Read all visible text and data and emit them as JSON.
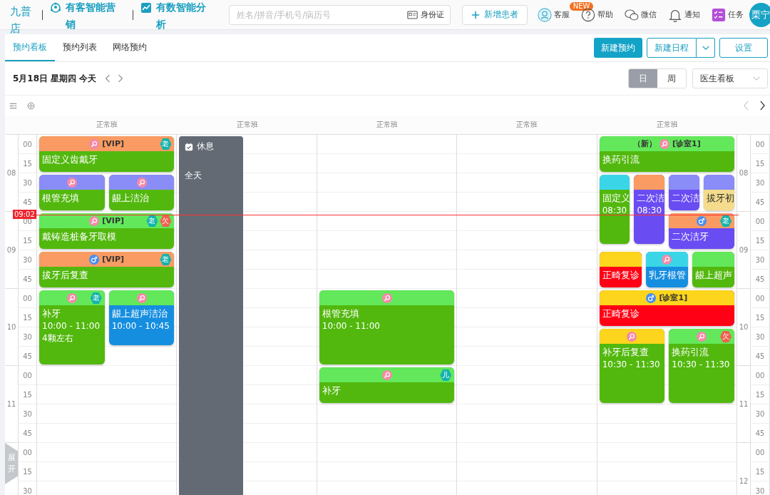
{
  "brand": {
    "name": "九普店"
  },
  "top_links": [
    {
      "kind": "marketing",
      "label": "有客智能营销"
    },
    {
      "kind": "analytics",
      "label": "有数智能分析"
    }
  ],
  "search": {
    "placeholder": "姓名/拼音/手机号/病历号",
    "id_button": "身份证"
  },
  "add_patient": "新增患者",
  "nav": [
    {
      "kind": "service",
      "label": "客服"
    },
    {
      "kind": "help",
      "label": "帮助",
      "badge": "NEW"
    },
    {
      "kind": "wechat",
      "label": "微信"
    },
    {
      "kind": "bell",
      "label": "通知"
    },
    {
      "kind": "tasks",
      "label": "任务"
    }
  ],
  "user": {
    "avatar": "栗宁"
  },
  "tabs": [
    {
      "label": "预约看板",
      "selected": true
    },
    {
      "label": "预约列表",
      "selected": false
    },
    {
      "label": "网络预约",
      "selected": false
    }
  ],
  "actions": {
    "new_appointment": "新建预约",
    "new_schedule": "新建日程",
    "settings": "设置"
  },
  "date": "5月18日 星期四 今天",
  "view_modes": [
    {
      "label": "日",
      "selected": true
    },
    {
      "label": "周",
      "selected": false
    }
  ],
  "board_select": "医生看板",
  "now": "09:02",
  "expand": "展开",
  "left_hours": [
    {
      "label": "08",
      "minutes": [
        "00",
        "15",
        "30",
        "45"
      ]
    },
    {
      "label": "09",
      "minutes": [
        "00",
        "15",
        "30",
        "45"
      ]
    },
    {
      "label": "10",
      "minutes": [
        "00",
        "15",
        "30",
        "45"
      ]
    },
    {
      "label": "11",
      "minutes": [
        "00",
        "15",
        "30",
        "45"
      ]
    },
    {
      "minutes": [
        "00",
        "15",
        "30"
      ]
    }
  ],
  "right_hours": [
    {
      "label": "08",
      "minutes": [
        "00",
        "15",
        "30",
        "45"
      ]
    },
    {
      "label": "09",
      "minutes": [
        "00",
        "15",
        "30",
        "45"
      ]
    },
    {
      "label": "10",
      "minutes": [
        "00",
        "15",
        "30",
        "45"
      ]
    },
    {
      "label": "11",
      "minutes": [
        "00",
        "15",
        "30",
        "45"
      ]
    },
    {
      "label": "12",
      "minutes": [
        "00",
        "15",
        "30"
      ]
    }
  ],
  "columns": [
    {
      "shift": "正常班",
      "events": [
        {
          "kind": "appointment",
          "color": "#52b80e",
          "header": {
            "color": "#f99b62"
          },
          "icon": {
            "kind": "female"
          },
          "tag": "[VIP]",
          "badges": [
            {
              "text": "老",
              "color": "#12b3ad"
            }
          ],
          "lines": [
            "固定义齿戴牙"
          ]
        },
        {
          "kind": "appointment",
          "color": "#52b80e",
          "header": {
            "color": "#8a8cf8"
          },
          "icon": {
            "kind": "female"
          },
          "lines": [
            "根管充填"
          ]
        },
        {
          "kind": "appointment",
          "color": "#52b80e",
          "header": {
            "color": "#8a8cf8"
          },
          "icon": {
            "kind": "female"
          },
          "lines": [
            "龈上洁治"
          ]
        },
        {
          "kind": "appointment",
          "color": "#52b80e",
          "header": {
            "color": "#62e85a"
          },
          "icon": {
            "kind": "female"
          },
          "tag": "[VIP]",
          "badges": [
            {
              "text": "老",
              "color": "#12b3ad"
            },
            {
              "text": "欠",
              "color": "#f0604f"
            }
          ],
          "lines": [
            "戴铸造桩备牙取模"
          ]
        },
        {
          "kind": "appointment",
          "color": "#52b80e",
          "header": {
            "color": "#f99b62"
          },
          "icon": {
            "kind": "male"
          },
          "tag": "[VIP]",
          "badges": [
            {
              "text": "老",
              "color": "#12b3ad"
            }
          ],
          "lines": [
            "拔牙后复查"
          ]
        },
        {
          "kind": "appointment",
          "color": "#52b80e",
          "header": {
            "color": "#62e85a"
          },
          "icon": {
            "kind": "female"
          },
          "badges": [
            {
              "text": "老",
              "color": "#12b3ad"
            }
          ],
          "lines": [
            "补牙",
            "10:00 - 11:00",
            "4颗左右"
          ]
        },
        {
          "kind": "appointment",
          "color": "#168ee0",
          "header": {
            "color": "#62e85a"
          },
          "icon": {
            "kind": "female"
          },
          "lines": [
            "龈上超声洁治",
            "10:00 - 10:45"
          ]
        }
      ]
    },
    {
      "shift": "正常班",
      "events": [
        {
          "kind": "rest",
          "color": "#636a73",
          "title": "休息",
          "note": "全天"
        }
      ]
    },
    {
      "shift": "正常班",
      "events": [
        {
          "kind": "appointment",
          "color": "#52b80e",
          "header": {
            "color": "#62e85a"
          },
          "icon": {
            "kind": "female"
          },
          "lines": [
            "根管充填",
            "10:00 - 11:00"
          ]
        },
        {
          "kind": "appointment",
          "color": "#52b80e",
          "header": {
            "color": "#62e85a"
          },
          "icon": {
            "kind": "female"
          },
          "badges": [
            {
              "text": "儿",
              "color": "#12b3ad"
            }
          ],
          "lines": [
            "补牙"
          ]
        }
      ]
    },
    {
      "shift": "正常班"
    },
    {
      "shift": "正常班",
      "events": [
        {
          "kind": "appointment",
          "color": "#52b80e",
          "header": {
            "color": "#62e85a"
          },
          "icon": {
            "kind": "female"
          },
          "prefix": "（新）",
          "tag": "[诊室1]",
          "lines": [
            "换药引流"
          ]
        },
        {
          "kind": "appointment",
          "color": "#52b80e",
          "header": {
            "color": "#3ad6e8"
          },
          "lines": [
            "固定义",
            "08:30"
          ]
        },
        {
          "kind": "appointment",
          "color": "#6a4cf3",
          "header": {
            "color": "#f99b62"
          },
          "lines": [
            "二次洁",
            "08:30"
          ]
        },
        {
          "kind": "appointment",
          "color": "#6a4cf3",
          "header": {
            "color": "#8a8cf8"
          },
          "lines": [
            "二次洁"
          ]
        },
        {
          "kind": "appointment",
          "color": "#f4dc8c",
          "header": {
            "color": "#8a8cf8"
          },
          "lines": [
            "拔牙初"
          ]
        },
        {
          "kind": "appointment",
          "color": "#6a4cf3",
          "header": {
            "color": "#f99b62"
          },
          "icon": {
            "kind": "male"
          },
          "badges": [
            {
              "text": "老",
              "color": "#12b3ad"
            }
          ],
          "lines": [
            "二次洁牙"
          ]
        },
        {
          "kind": "appointment",
          "color": "#ff0014",
          "header": {
            "color": "#fdd51c"
          },
          "lines": [
            "正畸复诊"
          ]
        },
        {
          "kind": "appointment",
          "color": "#168ee0",
          "header": {
            "color": "#3ad6e8"
          },
          "icon": {
            "kind": "female"
          },
          "lines": [
            "乳牙根管"
          ]
        },
        {
          "kind": "appointment",
          "color": "#52b80e",
          "header": {
            "color": "#62e85a"
          },
          "lines": [
            "龈上超声"
          ]
        },
        {
          "kind": "appointment",
          "color": "#ff0014",
          "header": {
            "color": "#fdd51c"
          },
          "icon": {
            "kind": "male"
          },
          "tag": "[诊室1]",
          "lines": [
            "正畸复诊"
          ]
        },
        {
          "kind": "appointment",
          "color": "#52b80e",
          "header": {
            "color": "#fdd51c"
          },
          "icon": {
            "kind": "female"
          },
          "lines": [
            "补牙后复查",
            "10:30 - 11:30"
          ]
        },
        {
          "kind": "appointment",
          "color": "#52b80e",
          "header": {
            "color": "#62e85a"
          },
          "icon": {
            "kind": "female"
          },
          "badges": [
            {
              "text": "欠",
              "color": "#f0604f"
            }
          ],
          "lines": [
            "换药引流",
            "10:30 - 11:30"
          ]
        }
      ]
    }
  ]
}
